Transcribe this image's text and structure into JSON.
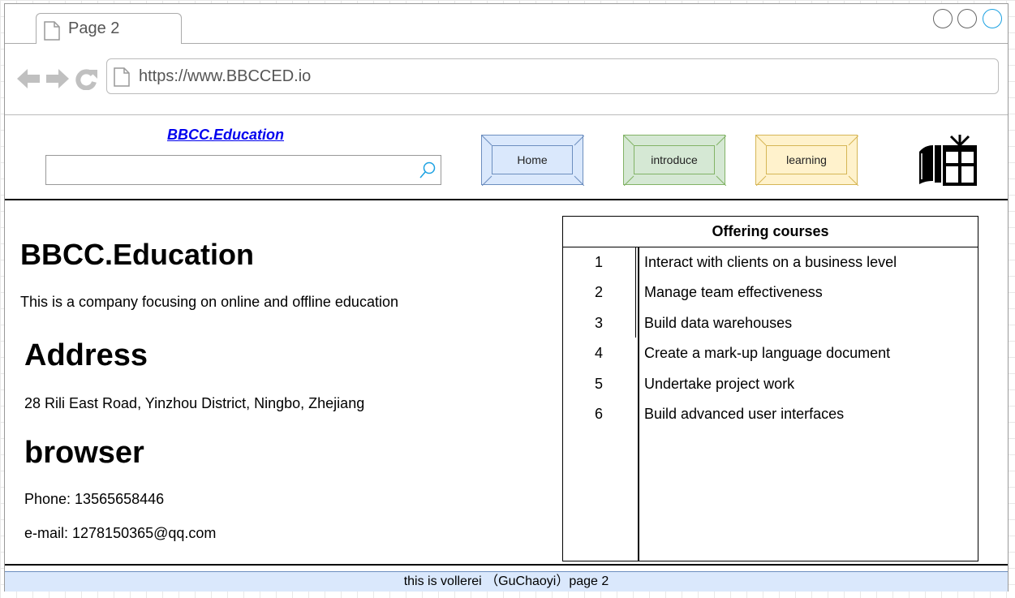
{
  "browser": {
    "tab_title": "Page 2",
    "url": "https://www.BBCCED.io",
    "window_buttons": [
      "minimize",
      "maximize",
      "close"
    ],
    "close_color": "#1ba1e2"
  },
  "header": {
    "site_link": "BBCC.Education",
    "search_value": "",
    "nav": [
      {
        "label": "Home",
        "color": "#dae8fc"
      },
      {
        "label": "introduce",
        "color": "#d5e8d4"
      },
      {
        "label": "learning",
        "color": "#fff2cc"
      }
    ],
    "right_icon": "book-gift-icon"
  },
  "main": {
    "company_title": "BBCC.Education",
    "description": "This is a company focusing on online and offline education",
    "address_heading": "Address",
    "address": "28 Rili East Road, Yinzhou District, Ningbo, Zhejiang",
    "browser_heading": "browser",
    "phone": "Phone:  13565658446",
    "email": "e-mail: 1278150365@qq.com"
  },
  "courses": {
    "title": "Offering courses",
    "rows": [
      {
        "num": "1",
        "name": "Interact with clients on a business level"
      },
      {
        "num": "2",
        "name": "Manage team effectiveness"
      },
      {
        "num": "3",
        "name": "Build data warehouses"
      },
      {
        "num": "4",
        "name": "Create a mark-up language document"
      },
      {
        "num": "5",
        "name": "Undertake project work"
      },
      {
        "num": "6",
        "name": "Build advanced user interfaces"
      }
    ]
  },
  "footer": {
    "text": "this is vollerei （GuChaoyi）page 2"
  }
}
